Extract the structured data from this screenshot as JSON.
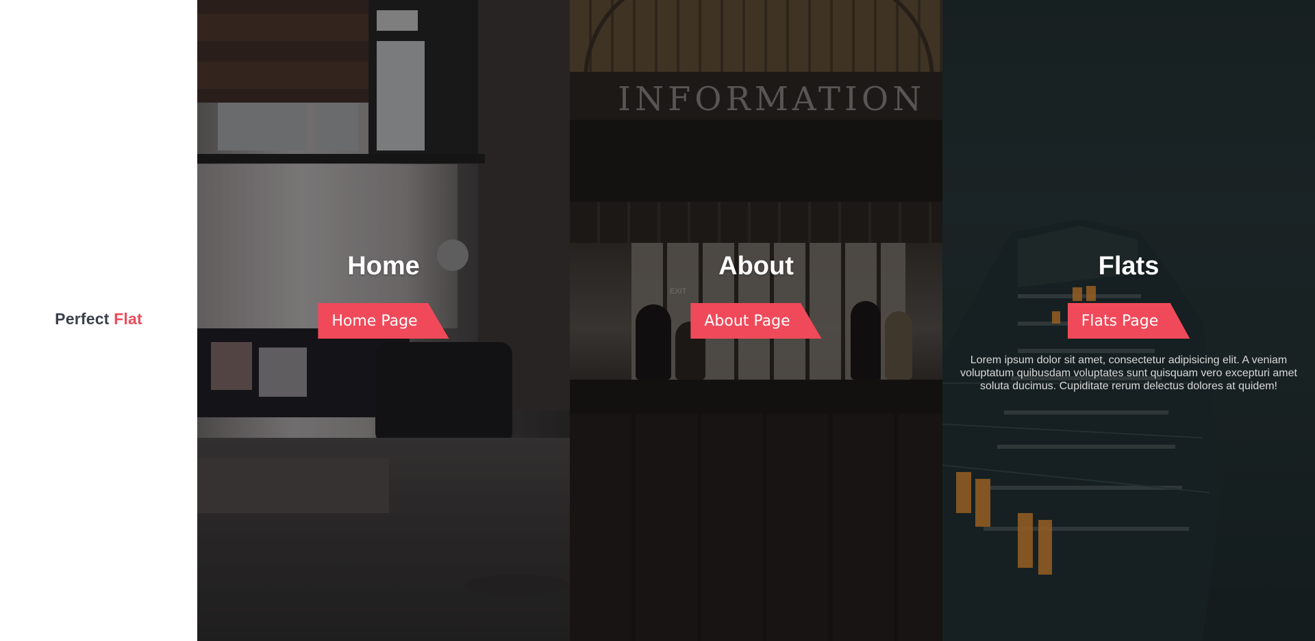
{
  "brand": {
    "prefix": "Perfect",
    "accent": "Flat",
    "accent_color": "#f04a5a",
    "text_color": "#3a3f4b"
  },
  "panels": [
    {
      "title": "Home",
      "button_label": "Home Page",
      "text": ""
    },
    {
      "title": "About",
      "button_label": "About Page",
      "text": ""
    },
    {
      "title": "Flats",
      "button_label": "Flats Page",
      "text": "Lorem ipsum dolor sit amet, consectetur adipisicing elit. A veniam voluptatum quibusdam voluptates sunt quisquam vero excepturi amet soluta ducimus. Cupiditate rerum delectus dolores at quidem!"
    }
  ],
  "about_sign": "INFORMATION",
  "about_exit": "EXIT",
  "button_color": "#f04a5a"
}
